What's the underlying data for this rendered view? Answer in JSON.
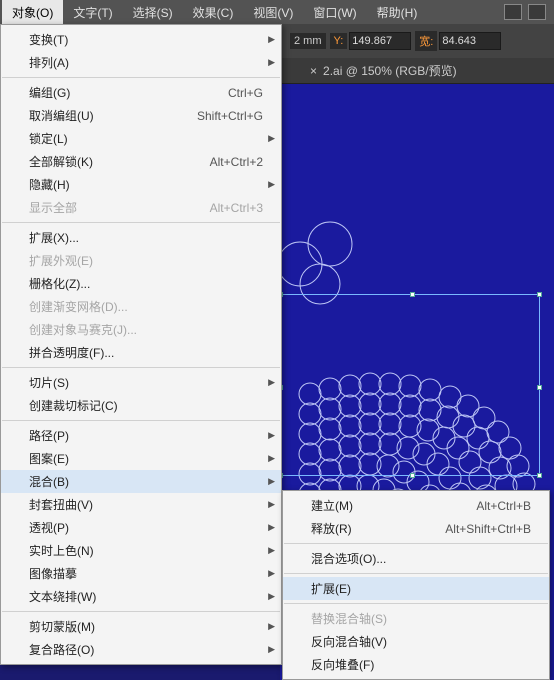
{
  "menubar": {
    "items": [
      "对象(O)",
      "文字(T)",
      "选择(S)",
      "效果(C)",
      "视图(V)",
      "窗口(W)",
      "帮助(H)"
    ]
  },
  "toolbar": {
    "x_label": "2 mm",
    "y_label": "Y:",
    "y_value": "149.867",
    "w_label": "宽:",
    "w_value": "84.643"
  },
  "tab": {
    "title": "2.ai @ 150% (RGB/预览)",
    "close": "×"
  },
  "menu": {
    "groups": [
      [
        {
          "label": "变换(T)",
          "arrow": true
        },
        {
          "label": "排列(A)",
          "arrow": true
        }
      ],
      [
        {
          "label": "编组(G)",
          "shortcut": "Ctrl+G"
        },
        {
          "label": "取消编组(U)",
          "shortcut": "Shift+Ctrl+G"
        },
        {
          "label": "锁定(L)",
          "arrow": true
        },
        {
          "label": "全部解锁(K)",
          "shortcut": "Alt+Ctrl+2"
        },
        {
          "label": "隐藏(H)",
          "arrow": true
        },
        {
          "label": "显示全部",
          "shortcut": "Alt+Ctrl+3",
          "disabled": true
        }
      ],
      [
        {
          "label": "扩展(X)..."
        },
        {
          "label": "扩展外观(E)",
          "disabled": true
        },
        {
          "label": "栅格化(Z)..."
        },
        {
          "label": "创建渐变网格(D)...",
          "disabled": true
        },
        {
          "label": "创建对象马赛克(J)...",
          "disabled": true
        },
        {
          "label": "拼合透明度(F)..."
        }
      ],
      [
        {
          "label": "切片(S)",
          "arrow": true
        },
        {
          "label": "创建裁切标记(C)"
        }
      ],
      [
        {
          "label": "路径(P)",
          "arrow": true
        },
        {
          "label": "图案(E)",
          "arrow": true
        },
        {
          "label": "混合(B)",
          "arrow": true,
          "hl": true
        },
        {
          "label": "封套扭曲(V)",
          "arrow": true
        },
        {
          "label": "透视(P)",
          "arrow": true
        },
        {
          "label": "实时上色(N)",
          "arrow": true
        },
        {
          "label": "图像描摹",
          "arrow": true
        },
        {
          "label": "文本绕排(W)",
          "arrow": true
        }
      ],
      [
        {
          "label": "剪切蒙版(M)",
          "arrow": true
        },
        {
          "label": "复合路径(O)",
          "arrow": true
        }
      ]
    ]
  },
  "submenu": {
    "groups": [
      [
        {
          "label": "建立(M)",
          "shortcut": "Alt+Ctrl+B"
        },
        {
          "label": "释放(R)",
          "shortcut": "Alt+Shift+Ctrl+B"
        }
      ],
      [
        {
          "label": "混合选项(O)..."
        }
      ],
      [
        {
          "label": "扩展(E)",
          "hl": true
        }
      ],
      [
        {
          "label": "替换混合轴(S)",
          "disabled": true
        },
        {
          "label": "反向混合轴(V)"
        },
        {
          "label": "反向堆叠(F)"
        }
      ]
    ]
  }
}
